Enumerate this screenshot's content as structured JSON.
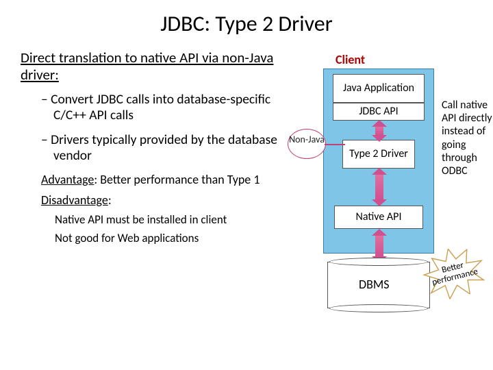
{
  "title": "JDBC:  Type 2 Driver",
  "subtitle": "Direct translation to native API via non-Java driver:",
  "bullets": [
    "Convert JDBC calls into database-specific C/C++ API calls",
    "Drivers typically provided by the database vendor"
  ],
  "advantage_label": "Advantage",
  "advantage_text": ":  Better performance than Type 1",
  "disadvantage_label": "Disadvantage",
  "disadvantage_text": ":",
  "disadvantage_items": [
    "Native API must be installed in client",
    "Not good for Web applications"
  ],
  "diagram": {
    "client_label": "Client",
    "java_app": "Java Application",
    "jdbc_api": "JDBC API",
    "type2": "Type 2 Driver",
    "native_api": "Native API",
    "dbms": "DBMS",
    "nonjava": "Non-Java",
    "note": "Call native API directly instead of going through ODBC",
    "starburst": "Better performance"
  }
}
